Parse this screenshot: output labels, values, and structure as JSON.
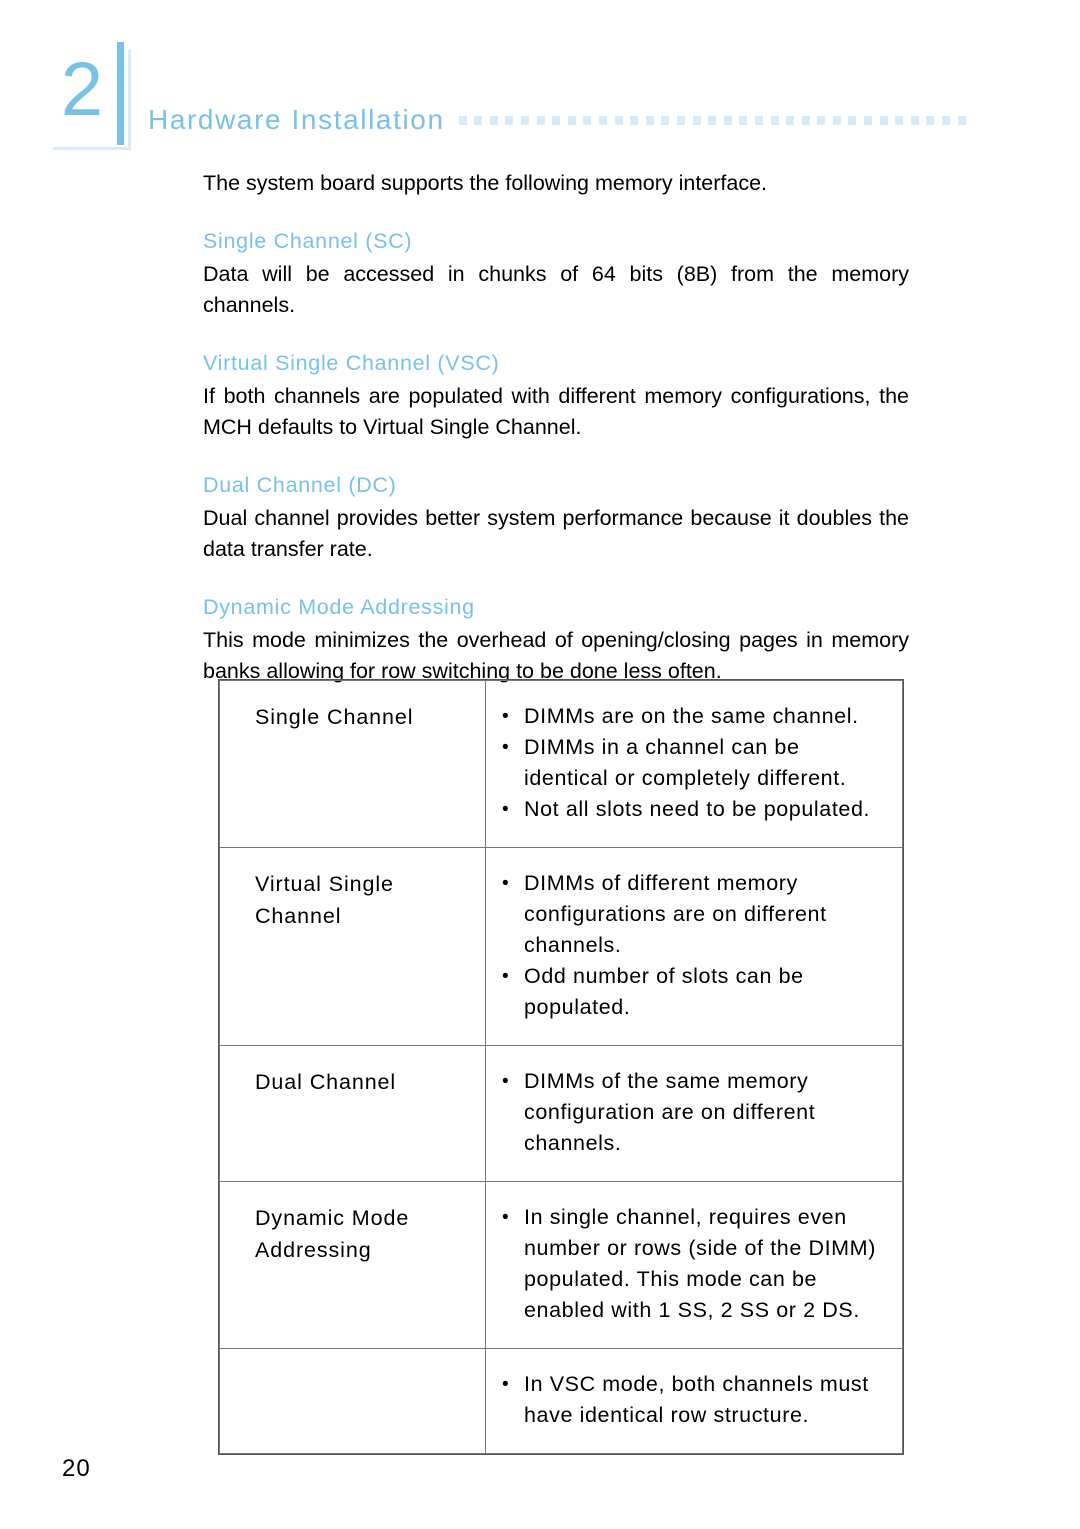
{
  "page": {
    "chapter_number": "2",
    "header_title": "Hardware Installation",
    "page_number": "20",
    "accent_color": "#79c2e6",
    "rule_dot_color": "#d6ebf7",
    "rule_dot_count": 33
  },
  "intro": {
    "text": "The system board supports the following memory interface."
  },
  "sections": [
    {
      "heading": "Single Channel (SC)",
      "body": "Data will be accessed in chunks of 64 bits (8B) from the memory channels."
    },
    {
      "heading": "Virtual Single Channel (VSC)",
      "body": "If both channels are populated with different memory configurations, the MCH defaults to Virtual Single Channel."
    },
    {
      "heading": "Dual Channel (DC)",
      "body": "Dual channel provides better system performance because it doubles the data transfer rate."
    },
    {
      "heading": "Dynamic Mode Addressing",
      "body": "This mode minimizes the overhead of opening/closing pages in memory banks allowing for row switching to be done less often."
    }
  ],
  "table": {
    "rows": [
      {
        "label": "Single Channel",
        "bullets": [
          "DIMMs are on the same channel.",
          "DIMMs in a channel can be identical or completely different.",
          "Not all slots need to be populated."
        ]
      },
      {
        "label": "Virtual Single Channel",
        "bullets": [
          "DIMMs of different memory configurations are on different channels.",
          "Odd number of slots can be populated."
        ]
      },
      {
        "label": "Dual Channel",
        "bullets": [
          "DIMMs of the same memory configuration are on different channels."
        ]
      },
      {
        "label": "Dynamic Mode Addressing",
        "bullets": [
          "In single channel, requires even number or rows (side of the DIMM) populated. This mode can be enabled with 1 SS, 2 SS or 2 DS."
        ]
      },
      {
        "label": "",
        "bullets": [
          "In VSC mode, both channels must have identical row structure."
        ]
      }
    ]
  }
}
